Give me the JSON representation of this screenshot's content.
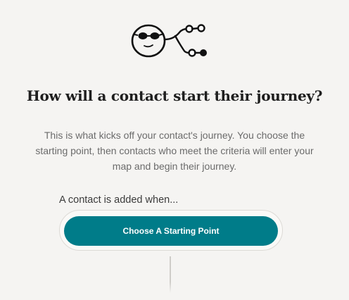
{
  "illustration": {
    "icon": "face-with-branching-path-icon"
  },
  "heading": {
    "title": "How will a contact start their journey?"
  },
  "intro": {
    "description": "This is what kicks off your contact's journey. You choose the starting point, then contacts who meet the criteria will enter your map and begin their journey."
  },
  "trigger": {
    "label": "A contact is added when...",
    "button_label": "Choose A Starting Point"
  },
  "colors": {
    "background": "#f5f4f2",
    "button": "#007c89",
    "button_text": "#ffffff"
  }
}
